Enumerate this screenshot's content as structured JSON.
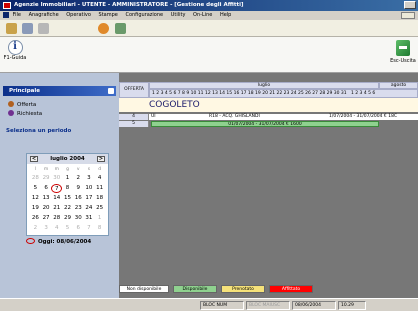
{
  "window": {
    "title": "Agenzie Immobiliari - UTENTE - AMMINISTRATORE - [Gestione degli Affitti]"
  },
  "menu": {
    "items": [
      "File",
      "Anagrafiche",
      "Operativo",
      "Stampe",
      "Configurazione",
      "Utility",
      "On-Line",
      "Help"
    ]
  },
  "toolbar": {
    "guide_label": "F1-Guida",
    "exit_label": "Esc-Uscita",
    "icons": [
      "users-icon",
      "key-icon",
      "document-icon",
      "clock-icon",
      "gear-icon"
    ]
  },
  "sidebar": {
    "panel_title": "Principale",
    "items": [
      {
        "label": "Offerta",
        "icon": "person-icon"
      },
      {
        "label": "Richiesta",
        "icon": "person-icon"
      }
    ],
    "period_title": "Seleziona un periodo",
    "calendar": {
      "month_label": "luglio 2004",
      "prev": "<",
      "next": ">",
      "dow": [
        "l",
        "m",
        "m",
        "g",
        "v",
        "s",
        "d"
      ],
      "days": [
        "28",
        "29",
        "30",
        "1",
        "2",
        "3",
        "4",
        "5",
        "6",
        "7",
        "8",
        "9",
        "10",
        "11",
        "12",
        "13",
        "14",
        "15",
        "16",
        "17",
        "18",
        "19",
        "20",
        "21",
        "22",
        "23",
        "24",
        "25",
        "26",
        "27",
        "28",
        "29",
        "30",
        "31",
        "1",
        "2",
        "3",
        "4",
        "5",
        "6",
        "7",
        "8"
      ],
      "today_label": "Oggi: 08/06/2004"
    }
  },
  "grid": {
    "header_left": "OFFERTA",
    "month_main": "luglio",
    "month_next": "agosto",
    "days": "1 2 3 4 5 6 7 8 9 10 11 12 13 14 15 16 17 18 19 20 21 22 23 24 25 26 27 28 29 30 31",
    "days_next": "1 2 3 4 5 6",
    "location": "COGOLETO",
    "rows": [
      {
        "n": "4",
        "code": "UI",
        "desc": "R18 - ACQ. GHISLANDI",
        "period": "1/07/2004 - 31/07/2004 € 18C"
      },
      {
        "n": "5",
        "code": "",
        "desc": "",
        "period": "01/07/2004 - 31/07/2004 € 1600"
      }
    ]
  },
  "legend": {
    "items": [
      {
        "label": "Non disponibile",
        "color": "#ffffff"
      },
      {
        "label": "Disponibile",
        "color": "#8fd18f"
      },
      {
        "label": "Prenotato",
        "color": "#f6e27a"
      },
      {
        "label": "Affittato",
        "color": "#ff0000"
      }
    ]
  },
  "statusbar": {
    "cells": [
      "BLOC NUM",
      "BLOC MAIUSC",
      "08/06/2004",
      "10.29"
    ]
  }
}
